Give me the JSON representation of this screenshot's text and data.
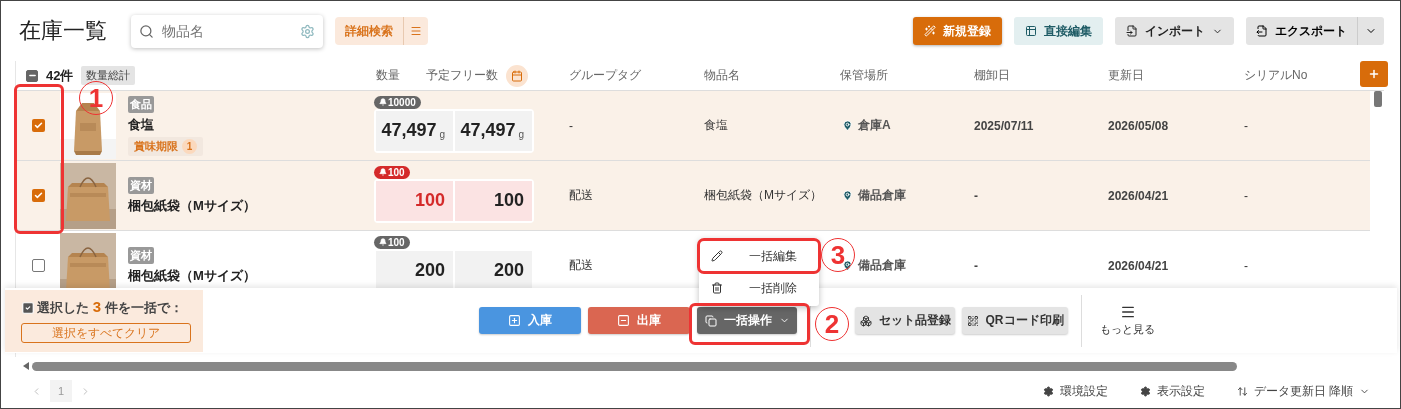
{
  "title": "在庫一覧",
  "search": {
    "placeholder": "物品名"
  },
  "advanced_search": "詳細検索",
  "actions": [
    {
      "label": "新規登録",
      "kind": "primary"
    },
    {
      "label": "直接編集",
      "kind": "teal"
    },
    {
      "label": "インポート",
      "kind": "dropdown"
    },
    {
      "label": "エクスポート",
      "kind": "split"
    }
  ],
  "table": {
    "indeterminate": true,
    "count": "42件",
    "total_chip": "数量総計",
    "columns": [
      "数量",
      "予定フリー数",
      "グループタグ",
      "物品名",
      "保管場所",
      "棚卸日",
      "更新日",
      "シリアルNo"
    ],
    "rows": [
      {
        "selected": true,
        "category": "食品",
        "name": "食塩",
        "badge": {
          "label": "賞味期限",
          "count": "1"
        },
        "alert_level": "10000",
        "low_stock": false,
        "quantity": "47,497",
        "unit": "g",
        "free": "47,497",
        "free_unit": "g",
        "group": "-",
        "item_name": "食塩",
        "location": "倉庫A",
        "stocktake": "2025/07/11",
        "updated": "2026/05/08",
        "serial": "-"
      },
      {
        "selected": true,
        "category": "資材",
        "name": "梱包紙袋（Mサイズ）",
        "alert_level": "100",
        "low_stock": true,
        "quantity": "100",
        "free": "100",
        "group": "配送",
        "item_name": "梱包紙袋（Mサイズ）",
        "location": "備品倉庫",
        "stocktake": "-",
        "updated": "2026/04/21",
        "serial": "-"
      },
      {
        "selected": false,
        "category": "資材",
        "name": "梱包紙袋（Mサイズ）",
        "alert_level": "100",
        "low_stock": false,
        "quantity": "200",
        "free": "200",
        "group": "配送",
        "location": "備品倉庫",
        "stocktake": "-",
        "updated": "2026/04/21",
        "serial": "-"
      }
    ]
  },
  "bulk_bar": {
    "summary": "選択した **3** 件を一括で：",
    "clear": "選択をすべてクリア",
    "buttons": [
      {
        "label": "入庫",
        "kind": "in"
      },
      {
        "label": "出庫",
        "kind": "out"
      },
      {
        "label": "一括操作",
        "kind": "menu"
      },
      {
        "label": "セット品登録",
        "kind": "set"
      },
      {
        "label": "QRコード印刷",
        "kind": "qr"
      }
    ],
    "more": "もっと見る"
  },
  "bulk_menu": [
    {
      "label": "一括編集",
      "kind": "edit"
    },
    {
      "label": "一括削除",
      "kind": "delete"
    }
  ],
  "footer": {
    "page": "1",
    "settings": [
      {
        "label": "環境設定"
      },
      {
        "label": "表示設定"
      }
    ],
    "sort": {
      "field": "データ更新日",
      "order": "降順"
    }
  },
  "annotations": [
    {
      "label": "1",
      "kind": "column"
    },
    {
      "label": "2",
      "kind": "button"
    },
    {
      "label": "3",
      "kind": "item"
    }
  ]
}
